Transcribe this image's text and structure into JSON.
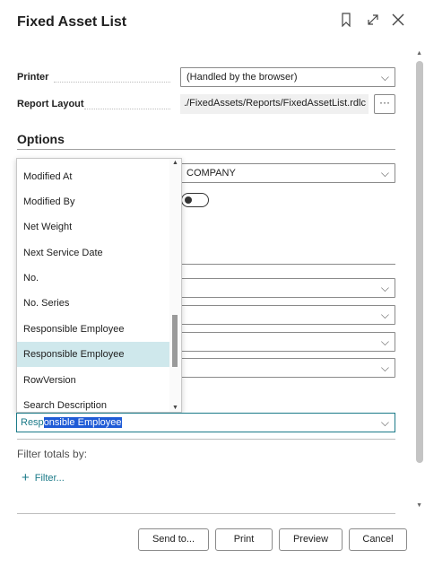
{
  "dialog": {
    "title": "Fixed Asset List"
  },
  "header_icons": [
    "bookmark-icon",
    "expand-icon",
    "close-icon"
  ],
  "fields": {
    "printer": {
      "label": "Printer",
      "value": "(Handled by the browser)"
    },
    "report_layout": {
      "label": "Report Layout",
      "value": "./FixedAssets/Reports/FixedAssetList.rdlc",
      "button": "···"
    }
  },
  "options": {
    "title": "Options",
    "company_value": "COMPANY"
  },
  "dropdown": {
    "items": [
      "Modified At",
      "Modified By",
      "Net Weight",
      "Next Service Date",
      "No.",
      "No. Series",
      "Responsible Employee",
      "Responsible Employee",
      "RowVersion",
      "Search Description"
    ],
    "selected_index": 7
  },
  "filter_field": {
    "typed": "Resp",
    "highlighted": "onsible Employee"
  },
  "filter_totals": {
    "label": "Filter totals by:",
    "add_label": "Filter..."
  },
  "buttons": {
    "send_to": "Send to...",
    "print": "Print",
    "preview": "Preview",
    "cancel": "Cancel"
  },
  "colors": {
    "accent": "#1b7a88",
    "selected_row": "#cfe8ec",
    "text_highlight": "#1f5bd6"
  }
}
